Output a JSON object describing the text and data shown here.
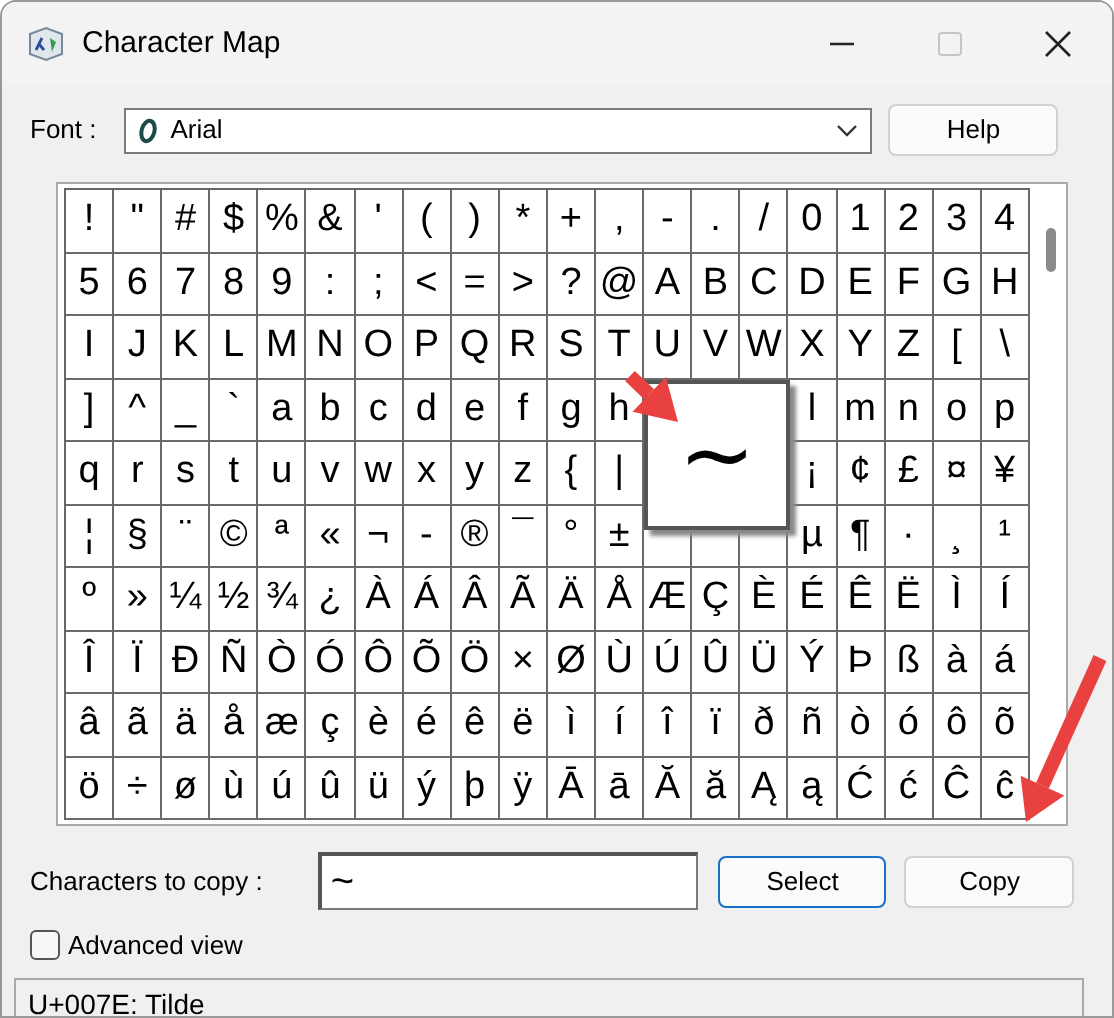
{
  "window": {
    "title": "Character Map",
    "controls": [
      {
        "kind": "minimize",
        "disabled": false
      },
      {
        "kind": "maximize",
        "disabled": true
      },
      {
        "kind": "close",
        "disabled": false
      }
    ]
  },
  "font": {
    "label": "Font :",
    "value": "Arial"
  },
  "help_button": "Help",
  "grid": {
    "rows": [
      [
        "!",
        "\"",
        "#",
        "$",
        "%",
        "&",
        "'",
        "(",
        ")",
        "*",
        "+",
        ",",
        "-",
        ".",
        "/",
        "0",
        "1",
        "2",
        "3",
        "4"
      ],
      [
        "5",
        "6",
        "7",
        "8",
        "9",
        ":",
        ";",
        "<",
        "=",
        ">",
        "?",
        "@",
        "A",
        "B",
        "C",
        "D",
        "E",
        "F",
        "G",
        "H"
      ],
      [
        "I",
        "J",
        "K",
        "L",
        "M",
        "N",
        "O",
        "P",
        "Q",
        "R",
        "S",
        "T",
        "U",
        "V",
        "W",
        "X",
        "Y",
        "Z",
        "[",
        "\\"
      ],
      [
        "]",
        "^",
        "_",
        "`",
        "a",
        "b",
        "c",
        "d",
        "e",
        "f",
        "g",
        "h",
        null,
        null,
        null,
        "l",
        "m",
        "n",
        "o",
        "p"
      ],
      [
        "q",
        "r",
        "s",
        "t",
        "u",
        "v",
        "w",
        "x",
        "y",
        "z",
        "{",
        "|",
        null,
        null,
        null,
        "¡",
        "¢",
        "£",
        "¤",
        "¥"
      ],
      [
        "¦",
        "§",
        "¨",
        "©",
        "ª",
        "«",
        "¬",
        "-",
        "®",
        "¯",
        "°",
        "±",
        null,
        null,
        null,
        "µ",
        "¶",
        "·",
        "¸",
        "¹"
      ],
      [
        "º",
        "»",
        "¼",
        "½",
        "¾",
        "¿",
        "À",
        "Á",
        "Â",
        "Ã",
        "Ä",
        "Å",
        "Æ",
        "Ç",
        "È",
        "É",
        "Ê",
        "Ë",
        "Ì",
        "Í"
      ],
      [
        "Î",
        "Ï",
        "Ð",
        "Ñ",
        "Ò",
        "Ó",
        "Ô",
        "Õ",
        "Ö",
        "×",
        "Ø",
        "Ù",
        "Ú",
        "Û",
        "Ü",
        "Ý",
        "Þ",
        "ß",
        "à",
        "á"
      ],
      [
        "â",
        "ã",
        "ä",
        "å",
        "æ",
        "ç",
        "è",
        "é",
        "ê",
        "ë",
        "ì",
        "í",
        "î",
        "ï",
        "ð",
        "ñ",
        "ò",
        "ó",
        "ô",
        "õ"
      ],
      [
        "ö",
        "÷",
        "ø",
        "ù",
        "ú",
        "û",
        "ü",
        "ý",
        "þ",
        "ÿ",
        "Ā",
        "ā",
        "Ă",
        "ă",
        "Ą",
        "ą",
        "Ć",
        "ć",
        "Ĉ",
        "ĉ"
      ]
    ],
    "magnified": "~"
  },
  "copy_label": "Characters to copy :",
  "copy_field": {
    "value": "~"
  },
  "buttons": [
    {
      "label": "Select",
      "selected": true
    },
    {
      "label": "Copy",
      "selected": false
    }
  ],
  "advanced_view": {
    "label": "Advanced view",
    "checked": false
  },
  "status_bar": "U+007E: Tilde",
  "annotations": [
    {
      "kind": "arrow"
    },
    {
      "kind": "arrow"
    }
  ]
}
